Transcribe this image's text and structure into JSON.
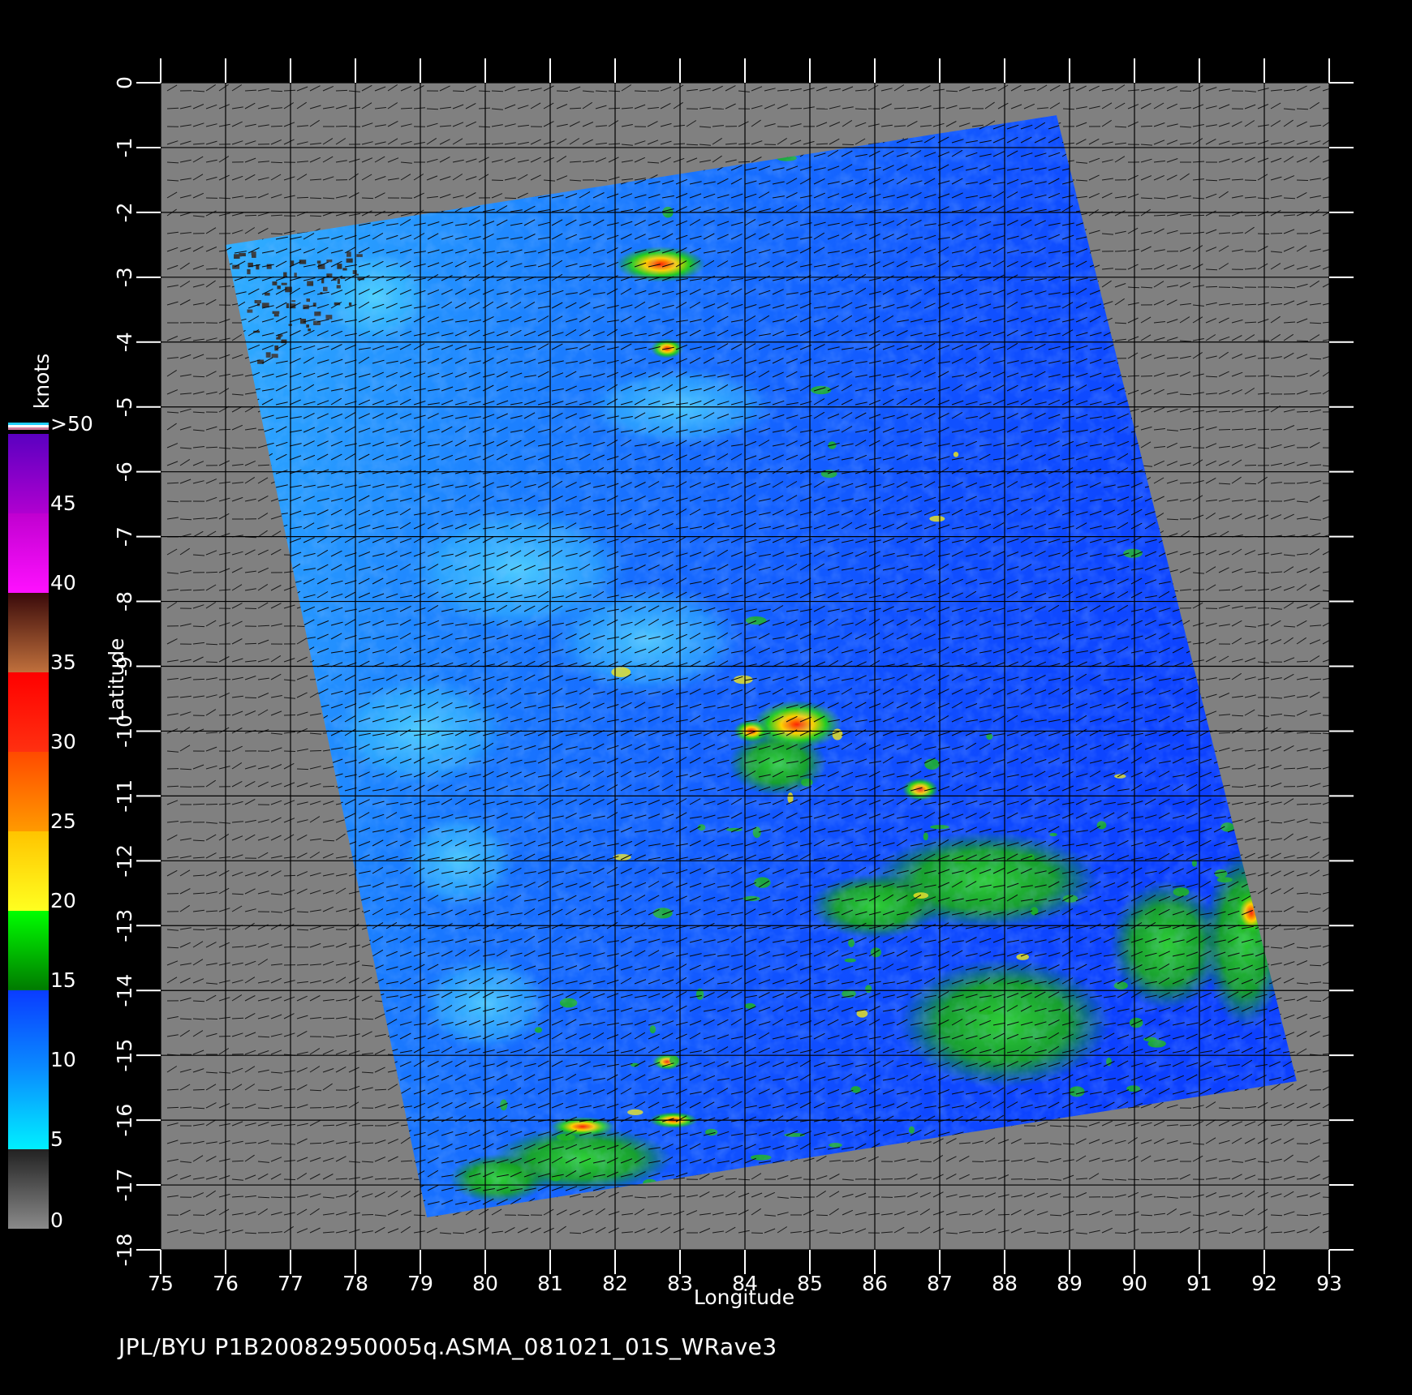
{
  "footer": "JPL/BYU  P1B20082950005q.ASMA_081021_01S_WRave3",
  "colorbar": {
    "unit": "knots",
    "labels": [
      "0",
      "5",
      "10",
      "15",
      "20",
      "25",
      "30",
      "35",
      "40",
      "45",
      ">50"
    ],
    "stops": [
      {
        "from": 0,
        "to": 5,
        "colors": [
          "#8a8a8a",
          "#222222"
        ]
      },
      {
        "from": 5,
        "to": 10,
        "colors": [
          "#00f0ff",
          "#0a8cff"
        ]
      },
      {
        "from": 10,
        "to": 15,
        "colors": [
          "#0a8cff",
          "#0a3cff"
        ]
      },
      {
        "from": 15,
        "to": 20,
        "colors": [
          "#007a00",
          "#00ff00"
        ]
      },
      {
        "from": 20,
        "to": 25,
        "colors": [
          "#ffff20",
          "#ffc400"
        ]
      },
      {
        "from": 25,
        "to": 30,
        "colors": [
          "#ff9a00",
          "#ff4a00"
        ]
      },
      {
        "from": 30,
        "to": 35,
        "colors": [
          "#ff3010",
          "#ff0000"
        ]
      },
      {
        "from": 35,
        "to": 40,
        "colors": [
          "#c0703c",
          "#3a0a0a"
        ]
      },
      {
        "from": 40,
        "to": 45,
        "colors": [
          "#ff10ff",
          "#c000d0"
        ]
      },
      {
        "from": 45,
        "to": 50,
        "colors": [
          "#b000d0",
          "#5a00c0"
        ]
      }
    ]
  },
  "chart_data": {
    "type": "heatmap",
    "title": "",
    "xlabel": "Longitude",
    "ylabel": "Latitude",
    "xlim": [
      75,
      93
    ],
    "ylim": [
      -18,
      0
    ],
    "xticks": [
      "75",
      "76",
      "77",
      "78",
      "79",
      "80",
      "81",
      "82",
      "83",
      "84",
      "85",
      "86",
      "87",
      "88",
      "89",
      "90",
      "91",
      "92",
      "93"
    ],
    "yticks": [
      "0",
      "-1",
      "-2",
      "-3",
      "-4",
      "-5",
      "-6",
      "-7",
      "-8",
      "-9",
      "-10",
      "-11",
      "-12",
      "-13",
      "-14",
      "-15",
      "-16",
      "-17",
      "-18"
    ],
    "grid": true,
    "swath_corners_lonlat": [
      [
        76.0,
        -2.5
      ],
      [
        88.8,
        -0.5
      ],
      [
        92.5,
        -15.4
      ],
      [
        79.1,
        -17.5
      ]
    ],
    "wind_regions": [
      {
        "label": "20-30 kt",
        "center": [
          82.7,
          -2.8
        ]
      },
      {
        "label": "20-30 kt",
        "center": [
          84.9,
          -9.9
        ]
      },
      {
        "label": "15-20 kt",
        "center": [
          88.0,
          -12.3
        ]
      },
      {
        "label": "15-20 kt",
        "center": [
          87.8,
          -14.6
        ]
      },
      {
        "label": "15-20 kt",
        "center": [
          81.3,
          -16.6
        ]
      },
      {
        "label": "20-30 kt",
        "center": [
          91.6,
          -12.6
        ]
      },
      {
        "label": "5-10 kt",
        "center": [
          83.2,
          -8.3
        ]
      }
    ]
  },
  "colors": {
    "background": "#000000",
    "land_mask": "#808080",
    "grid": "#000000",
    "axes": "#ffffff"
  }
}
